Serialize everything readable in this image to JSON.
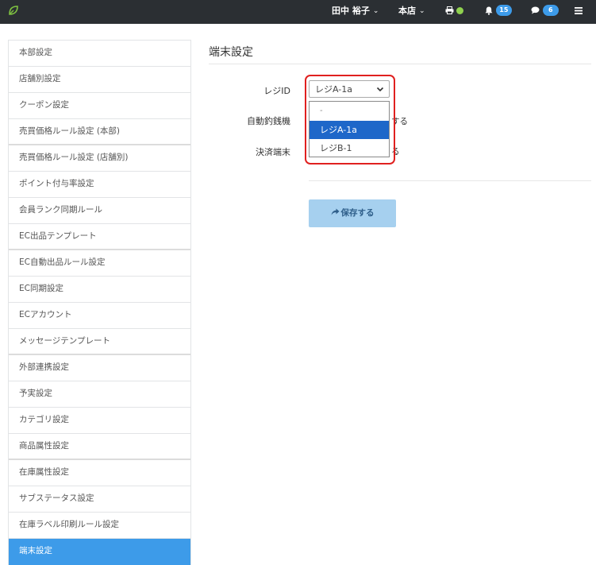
{
  "header": {
    "user_name": "田中 裕子",
    "store": "本店",
    "notifications_count": "15",
    "messages_count": "6",
    "status_color": "#8fd14f",
    "accent": "#3d9be9"
  },
  "sidebar": {
    "items": [
      {
        "label": "本部設定"
      },
      {
        "label": "店舗別設定"
      },
      {
        "label": "クーポン設定"
      },
      {
        "label": "売買価格ルール設定 (本部)"
      },
      {
        "label": "売買価格ルール設定 (店舗別)"
      },
      {
        "label": "ポイント付与率設定"
      },
      {
        "label": "会員ランク同期ルール"
      },
      {
        "label": "EC出品テンプレート"
      },
      {
        "label": "EC自動出品ルール設定"
      },
      {
        "label": "EC同期設定"
      },
      {
        "label": "ECアカウント"
      },
      {
        "label": "メッセージテンプレート"
      },
      {
        "label": "外部連携設定"
      },
      {
        "label": "予実設定"
      },
      {
        "label": "カテゴリ設定"
      },
      {
        "label": "商品属性設定"
      },
      {
        "label": "在庫属性設定"
      },
      {
        "label": "サブステータス設定"
      },
      {
        "label": "在庫ラベル印刷ルール設定"
      },
      {
        "label": "端末設定"
      }
    ],
    "active_index": 19
  },
  "main": {
    "title": "端末設定",
    "form": {
      "register_id_label": "レジID",
      "register_id_value": "レジA-1a",
      "register_id_options": [
        "-",
        "レジA-1a",
        "レジB-1"
      ],
      "auto_changer_label": "自動釣銭機",
      "auto_changer_partial": "する",
      "payment_terminal_label": "決済端末",
      "payment_terminal_partial": "る"
    },
    "save_label": "保存する"
  }
}
